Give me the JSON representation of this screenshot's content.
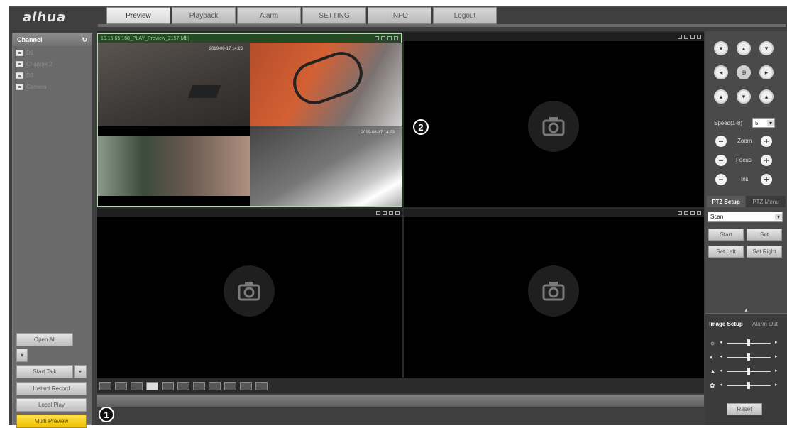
{
  "app": {
    "logo": "alhua"
  },
  "nav": {
    "tabs": [
      "Preview",
      "Playback",
      "Alarm",
      "SETTING",
      "INFO",
      "Logout"
    ],
    "active": "Preview"
  },
  "left": {
    "channel_header": "Channel",
    "channels": [
      "D1",
      "Channel 2",
      "D3",
      "Camera"
    ],
    "buttons": {
      "open_all": "Open All",
      "start_talk": "Start Talk",
      "instant_record": "Instant Record",
      "local_play": "Local Play",
      "multi_preview": "Multi Preview"
    }
  },
  "video": {
    "cell1_title": "10.15.65.168_PLAY_Preview_2157(Mb)",
    "cell1_osd": "2019-08-17 14:23",
    "icons": [
      "zoom-icon",
      "snapshot-icon",
      "record-icon",
      "audio-icon",
      "close-icon"
    ]
  },
  "ptz": {
    "speed_label": "Speed(1-8)",
    "speed_value": "5",
    "zoom_label": "Zoom",
    "focus_label": "Focus",
    "iris_label": "Iris",
    "tab_setup": "PTZ Setup",
    "tab_menu": "PTZ Menu",
    "mode_select": "Scan",
    "start": "Start",
    "set": "Set",
    "set_left": "Set Left",
    "set_right": "Set Right"
  },
  "image": {
    "tab_setup": "Image Setup",
    "tab_alarm": "Alarm Out",
    "reset": "Reset",
    "sliders": [
      {
        "name": "brightness",
        "level": 0.5
      },
      {
        "name": "contrast",
        "level": 0.5
      },
      {
        "name": "saturation",
        "level": 0.5
      },
      {
        "name": "hue",
        "level": 0.5
      }
    ]
  },
  "callouts": [
    "1",
    "2"
  ]
}
